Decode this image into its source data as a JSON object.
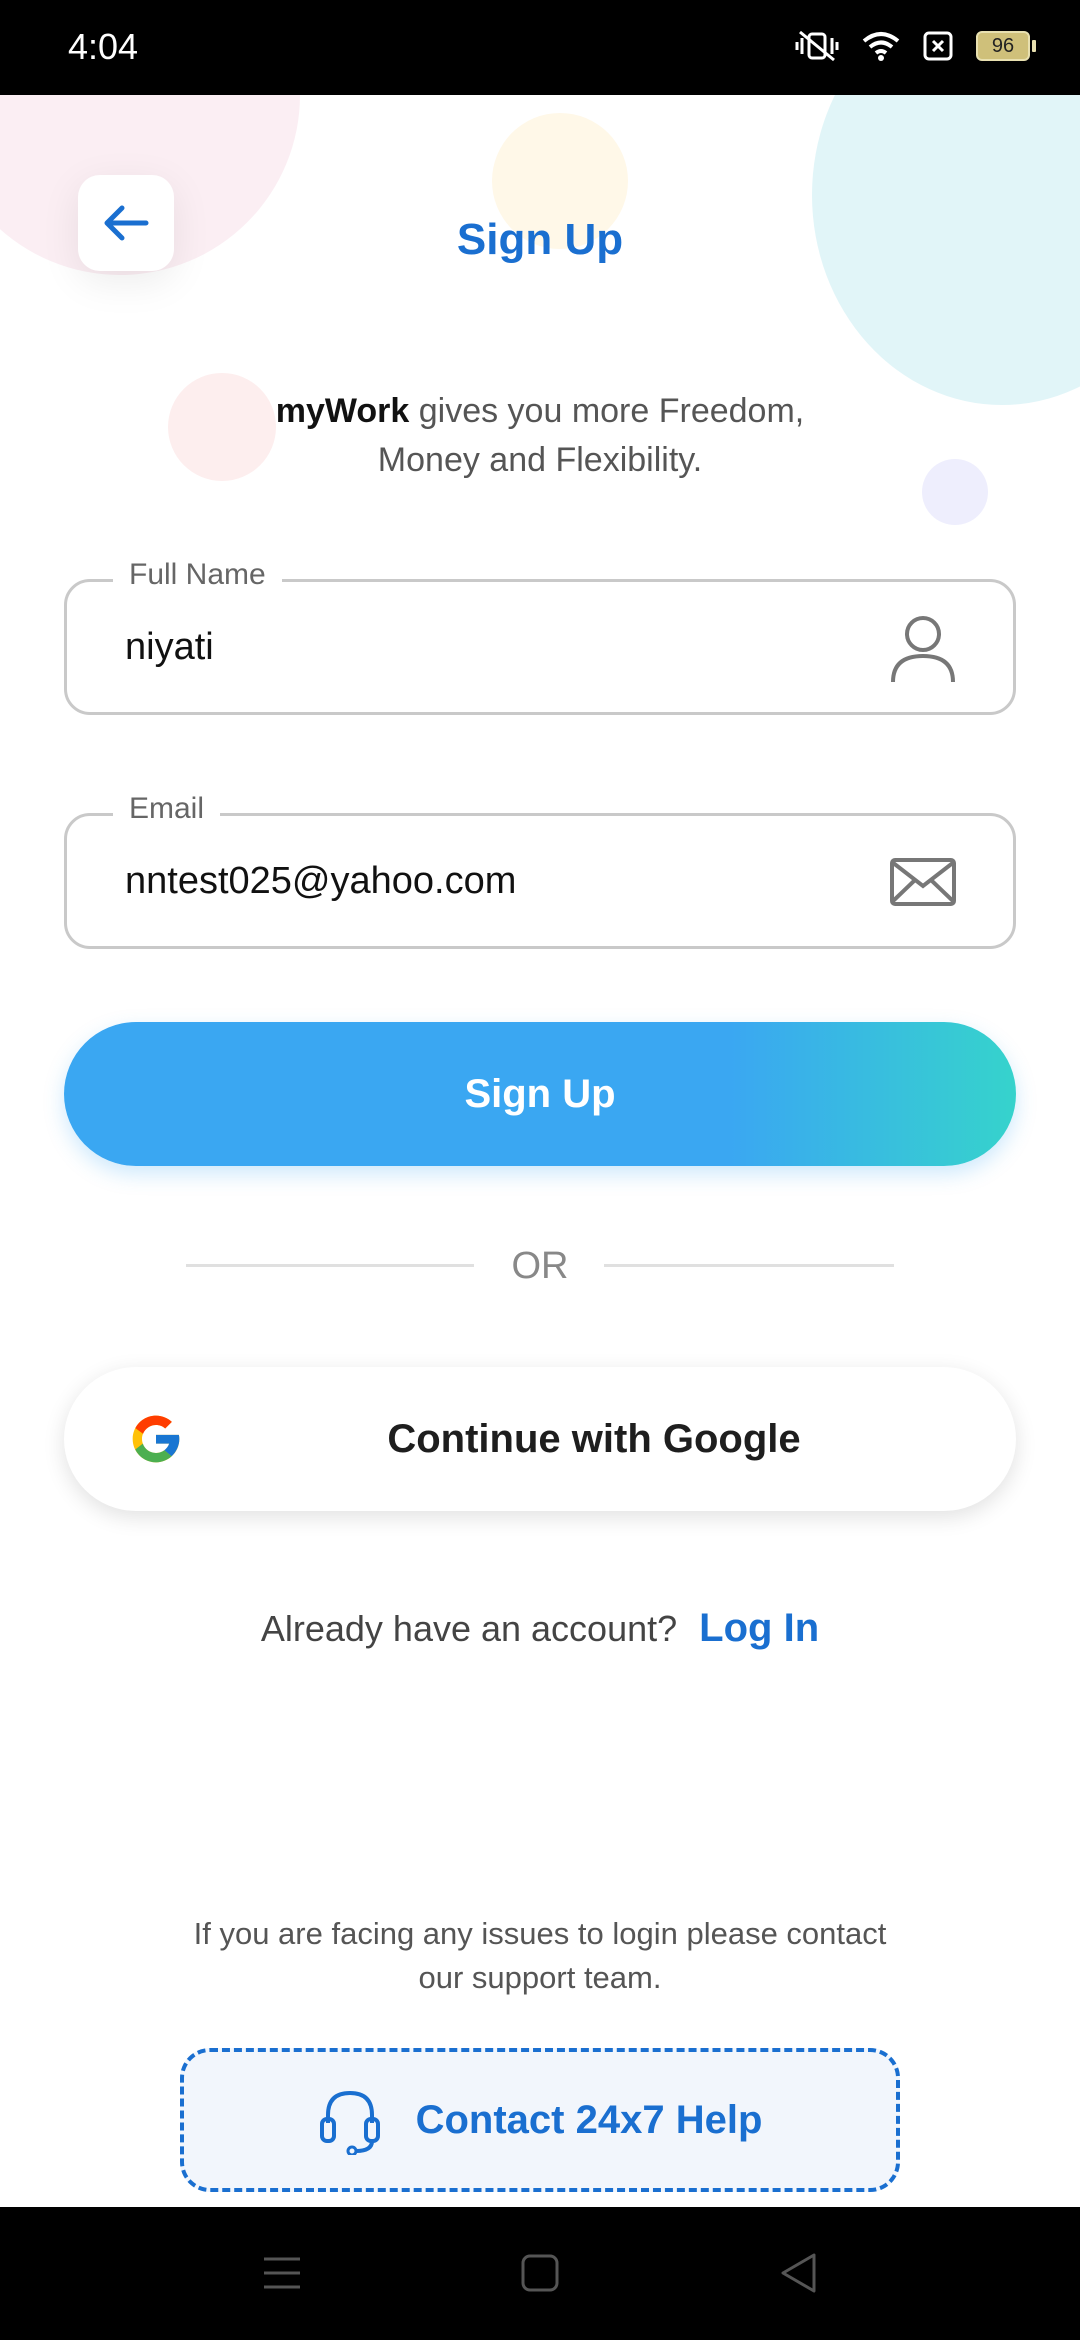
{
  "status_bar": {
    "time": "4:04",
    "battery": "96",
    "icons": [
      "vibrate-off-icon",
      "wifi-icon",
      "sim-blocked-icon",
      "battery-icon"
    ]
  },
  "header": {
    "title": "Sign Up",
    "back_icon": "arrow-left-icon"
  },
  "tagline": {
    "brand": "myWork",
    "rest_line1": " gives you more Freedom,",
    "line2": "Money and Flexibility."
  },
  "form": {
    "full_name": {
      "label": "Full Name",
      "value": "niyati",
      "icon": "person-icon"
    },
    "email": {
      "label": "Email",
      "value": "nntest025@yahoo.com",
      "icon": "mail-icon"
    }
  },
  "signup_button": {
    "label": "Sign Up"
  },
  "divider": {
    "label": "OR"
  },
  "google_button": {
    "label": "Continue with Google",
    "icon": "google-icon"
  },
  "login": {
    "prompt": "Already have an account?",
    "link": "Log In"
  },
  "support": {
    "line1": "If you are facing any issues to login please contact",
    "line2": "our support team.",
    "button_label": "Contact 24x7 Help",
    "button_icon": "headset-icon"
  },
  "nav_bar": {
    "icons": [
      "menu-icon",
      "home-square-icon",
      "back-triangle-icon"
    ]
  },
  "colors": {
    "accent_blue": "#1a6fd0",
    "gradient_start": "#3aa7f2",
    "gradient_end": "#36d3cc"
  }
}
